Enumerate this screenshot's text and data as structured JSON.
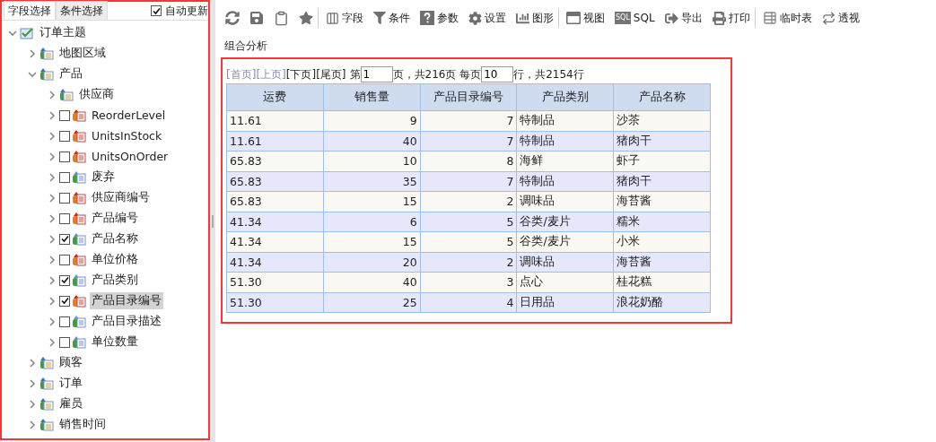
{
  "panel_tabs": [
    {
      "label": "字段选择",
      "selected": true
    },
    {
      "label": "条件选择",
      "selected": false
    }
  ],
  "auto_update": {
    "label": "自动更新",
    "checked": true
  },
  "tree": [
    {
      "label": "订单主题",
      "kind": "root",
      "expanded": true,
      "selected": false,
      "children": [
        {
          "label": "地图区域",
          "kind": "folder",
          "expanded": false,
          "selected": false
        },
        {
          "label": "产品",
          "kind": "folder",
          "expanded": true,
          "selected": false,
          "children": [
            {
              "label": "供应商",
              "kind": "folder",
              "expanded": false,
              "selected": false
            },
            {
              "label": "ReorderLevel",
              "kind": "measure",
              "expanded": false,
              "checked": false,
              "selected": false
            },
            {
              "label": "UnitsInStock",
              "kind": "measure",
              "expanded": false,
              "checked": false,
              "selected": false
            },
            {
              "label": "UnitsOnOrder",
              "kind": "measure",
              "expanded": false,
              "checked": false,
              "selected": false
            },
            {
              "label": "废弃",
              "kind": "dimension",
              "expanded": false,
              "checked": false,
              "selected": false
            },
            {
              "label": "供应商编号",
              "kind": "measure",
              "expanded": false,
              "checked": false,
              "selected": false
            },
            {
              "label": "产品编号",
              "kind": "measure",
              "expanded": false,
              "checked": false,
              "selected": false
            },
            {
              "label": "产品名称",
              "kind": "dimension",
              "expanded": false,
              "checked": true,
              "selected": false
            },
            {
              "label": "单位价格",
              "kind": "measure",
              "expanded": false,
              "checked": false,
              "selected": false
            },
            {
              "label": "产品类别",
              "kind": "dimension",
              "expanded": false,
              "checked": true,
              "selected": false
            },
            {
              "label": "产品目录编号",
              "kind": "measure",
              "expanded": false,
              "checked": true,
              "selected": true
            },
            {
              "label": "产品目录描述",
              "kind": "dimension",
              "expanded": false,
              "checked": false,
              "selected": false
            },
            {
              "label": "单位数量",
              "kind": "dimension",
              "expanded": false,
              "checked": false,
              "selected": false
            }
          ]
        },
        {
          "label": "顾客",
          "kind": "folder",
          "expanded": false,
          "selected": false
        },
        {
          "label": "订单",
          "kind": "folder",
          "expanded": false,
          "selected": false
        },
        {
          "label": "雇员",
          "kind": "folder",
          "expanded": false,
          "selected": false
        },
        {
          "label": "销售时间",
          "kind": "folder",
          "expanded": false,
          "selected": false
        }
      ]
    }
  ],
  "toolbar": [
    {
      "kind": "refresh",
      "separator_after": false
    },
    {
      "kind": "save",
      "separator_after": false
    },
    {
      "kind": "save-as",
      "separator_after": false
    },
    {
      "kind": "star",
      "separator_after": true
    },
    {
      "kind": "fields",
      "label": "字段",
      "separator_after": false
    },
    {
      "kind": "filter",
      "label": "条件",
      "separator_after": false
    },
    {
      "kind": "help",
      "label": "参数",
      "separator_after": false
    },
    {
      "kind": "gear",
      "label": "设置",
      "separator_after": false
    },
    {
      "kind": "chart",
      "label": "图形",
      "separator_after": true
    },
    {
      "kind": "view",
      "label": "视图",
      "separator_after": false
    },
    {
      "kind": "sql",
      "badge": "SQL",
      "label": "SQL",
      "separator_after": false
    },
    {
      "kind": "export",
      "label": "导出",
      "separator_after": false
    },
    {
      "kind": "print",
      "label": "打印",
      "separator_after": true
    },
    {
      "kind": "temp",
      "label": "临时表",
      "separator_after": false
    },
    {
      "kind": "pivot",
      "label": "透视",
      "separator_after": false
    }
  ],
  "report_title": "组合分析",
  "pager": {
    "links": [
      {
        "label": "[首页]",
        "disabled": true
      },
      {
        "label": "[上页]",
        "disabled": true
      },
      {
        "label": "[下页]",
        "disabled": false
      },
      {
        "label": "[尾页]",
        "disabled": false
      }
    ],
    "page_prefix": "第",
    "page_value": "1",
    "page_suffix": "页，共216页 每页",
    "rows_value": "10",
    "rows_suffix": "行，共2154行"
  },
  "table": {
    "columns": [
      {
        "label": "运费",
        "kind": "text"
      },
      {
        "label": "销售量",
        "kind": "number"
      },
      {
        "label": "产品目录编号",
        "kind": "number"
      },
      {
        "label": "产品类别",
        "kind": "text"
      },
      {
        "label": "产品名称",
        "kind": "text"
      }
    ],
    "rows": [
      [
        "11.61",
        "9",
        "7",
        "特制品",
        "沙茶"
      ],
      [
        "11.61",
        "40",
        "7",
        "特制品",
        "猪肉干"
      ],
      [
        "65.83",
        "10",
        "8",
        "海鲜",
        "虾子"
      ],
      [
        "65.83",
        "35",
        "7",
        "特制品",
        "猪肉干"
      ],
      [
        "65.83",
        "15",
        "2",
        "调味品",
        "海苔酱"
      ],
      [
        "41.34",
        "6",
        "5",
        "谷类/麦片",
        "糯米"
      ],
      [
        "41.34",
        "15",
        "5",
        "谷类/麦片",
        "小米"
      ],
      [
        "41.34",
        "20",
        "2",
        "调味品",
        "海苔酱"
      ],
      [
        "51.30",
        "40",
        "3",
        "点心",
        "桂花糕"
      ],
      [
        "51.30",
        "25",
        "4",
        "日用品",
        "浪花奶酪"
      ]
    ]
  }
}
